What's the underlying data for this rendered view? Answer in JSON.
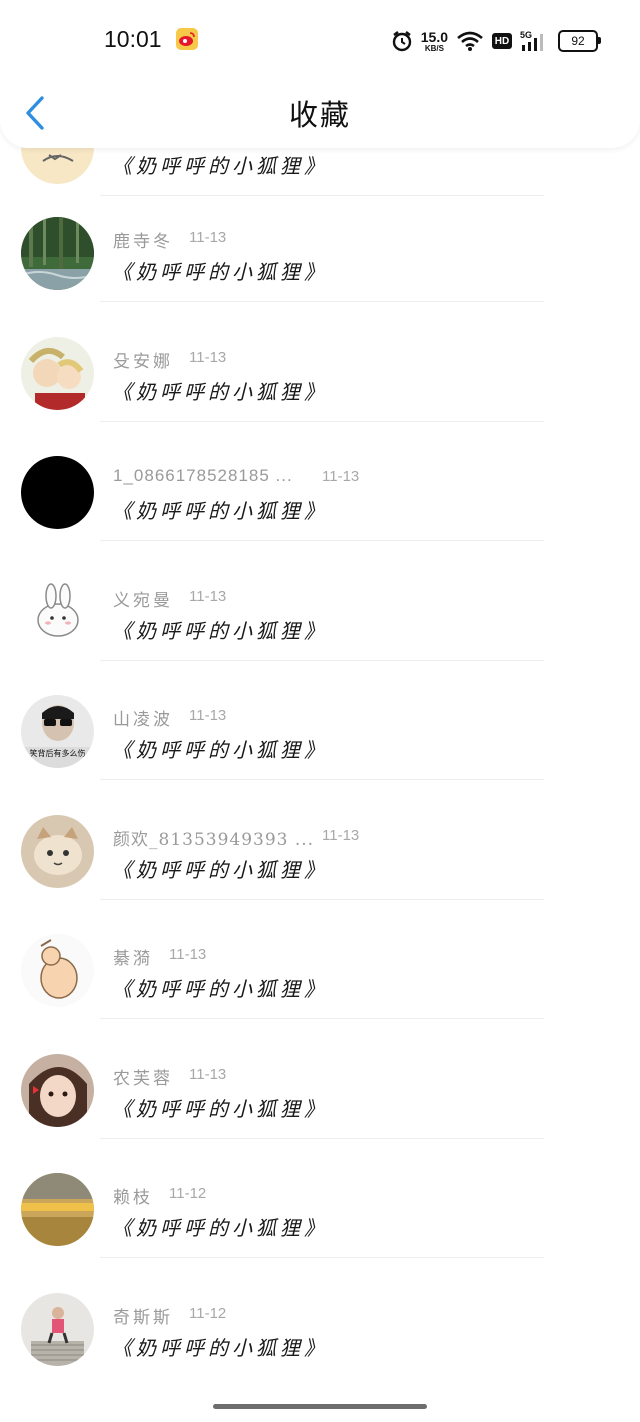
{
  "status_bar": {
    "time": "10:01",
    "net_speed_value": "15.0",
    "net_speed_unit": "KB/S",
    "hd": "HD",
    "network": "5G",
    "battery": "92"
  },
  "header": {
    "title": "收藏",
    "back_icon": "chevron-left-icon",
    "back_color": "#2f8ee0"
  },
  "list": {
    "items": [
      {
        "name": "",
        "date": "",
        "work": "《奶呼呼的小狐狸》"
      },
      {
        "name": "鹿寺冬",
        "date": "11-13",
        "work": "《奶呼呼的小狐狸》"
      },
      {
        "name": "殳安娜",
        "date": "11-13",
        "work": "《奶呼呼的小狐狸》"
      },
      {
        "name": "1_0866178528185 ...",
        "date": "11-13",
        "work": "《奶呼呼的小狐狸》"
      },
      {
        "name": "义宛曼",
        "date": "11-13",
        "work": "《奶呼呼的小狐狸》"
      },
      {
        "name": "山凌波",
        "date": "11-13",
        "work": "《奶呼呼的小狐狸》"
      },
      {
        "name": "颜欢_81353949393 ...",
        "date": "11-13",
        "work": "《奶呼呼的小狐狸》"
      },
      {
        "name": "綦漪",
        "date": "11-13",
        "work": "《奶呼呼的小狐狸》"
      },
      {
        "name": "农芙蓉",
        "date": "11-13",
        "work": "《奶呼呼的小狐狸》"
      },
      {
        "name": "赖枝",
        "date": "11-12",
        "work": "《奶呼呼的小狐狸》"
      },
      {
        "name": "奇斯斯",
        "date": "11-12",
        "work": "《奶呼呼的小狐狸》"
      }
    ],
    "avatar_overlay_text": "笑背后有多么伤"
  }
}
